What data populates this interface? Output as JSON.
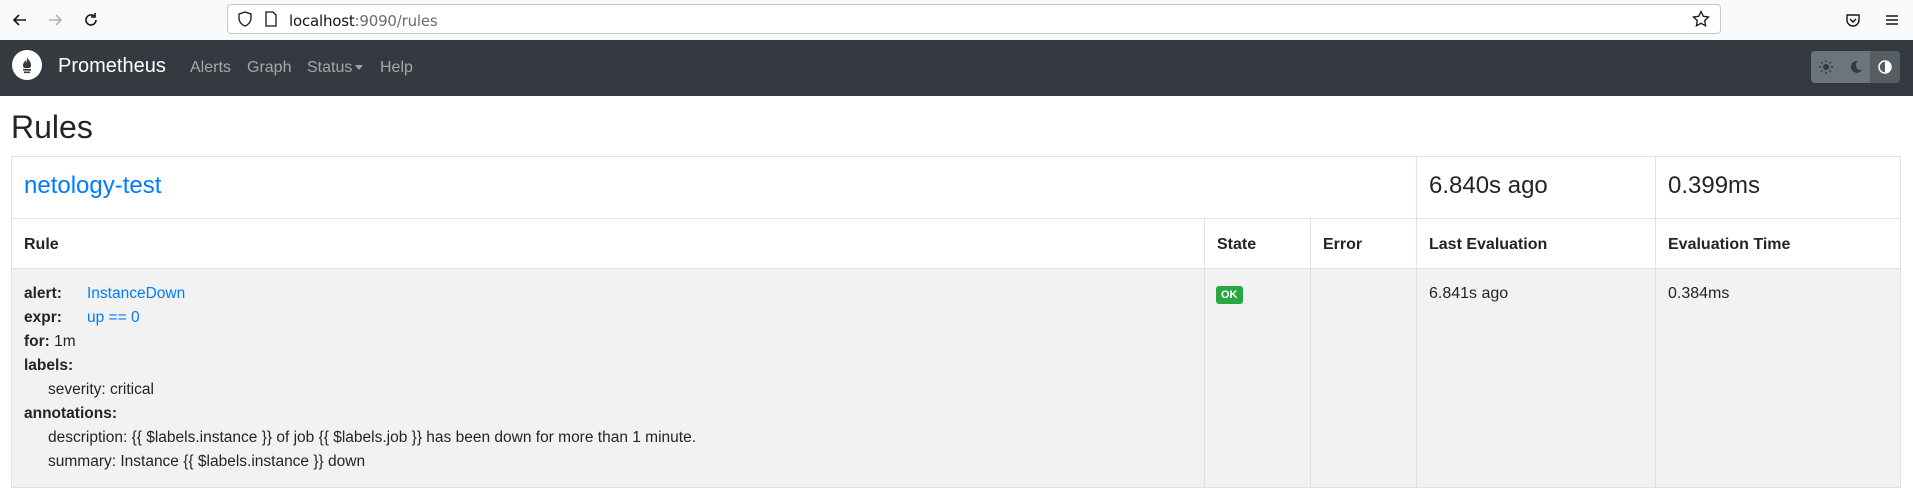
{
  "browser": {
    "url_host": "localhost",
    "url_rest": ":9090/rules"
  },
  "navbar": {
    "brand": "Prometheus",
    "links": [
      "Alerts",
      "Graph",
      "Status",
      "Help"
    ]
  },
  "page": {
    "title": "Rules"
  },
  "group": {
    "name": "netology-test",
    "last_evaluation": "6.840s ago",
    "evaluation_time": "0.399ms"
  },
  "table": {
    "headers": {
      "rule": "Rule",
      "state": "State",
      "error": "Error",
      "last_evaluation": "Last Evaluation",
      "evaluation_time": "Evaluation Time"
    }
  },
  "rule": {
    "alert_key": "alert:",
    "alert_value": "InstanceDown",
    "expr_key": "expr:",
    "expr_value": "up == 0",
    "for_key": "for:",
    "for_value": "1m",
    "labels_key": "labels:",
    "label_severity": "severity: critical",
    "annotations_key": "annotations:",
    "annotation_description": "description: {{ $labels.instance }} of job {{ $labels.job }} has been down for more than 1 minute.",
    "annotation_summary": "summary: Instance {{ $labels.instance }} down",
    "state": "OK",
    "error": "",
    "last_evaluation": "6.841s ago",
    "evaluation_time": "0.384ms"
  },
  "colors": {
    "navbar_bg": "#343a40",
    "link": "#007bff",
    "ok_badge": "#28a745"
  }
}
